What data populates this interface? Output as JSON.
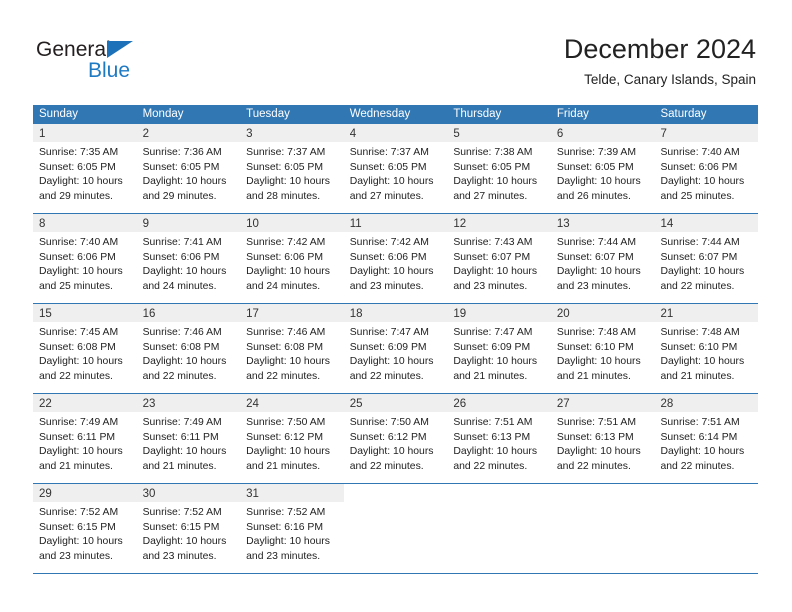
{
  "brand": {
    "name_part1": "General",
    "name_part2": "Blue",
    "triangle_color": "#1d71b8",
    "blue_color": "#1f7ac4"
  },
  "header": {
    "month_title": "December 2024",
    "location": "Telde, Canary Islands, Spain"
  },
  "theme": {
    "header_row_bg": "#3077b4",
    "daynum_bg": "#efefef",
    "text_color": "#222222"
  },
  "weekdays": [
    "Sunday",
    "Monday",
    "Tuesday",
    "Wednesday",
    "Thursday",
    "Friday",
    "Saturday"
  ],
  "weeks": [
    [
      {
        "day": "1",
        "sunrise": "Sunrise: 7:35 AM",
        "sunset": "Sunset: 6:05 PM",
        "daylight1": "Daylight: 10 hours",
        "daylight2": "and 29 minutes."
      },
      {
        "day": "2",
        "sunrise": "Sunrise: 7:36 AM",
        "sunset": "Sunset: 6:05 PM",
        "daylight1": "Daylight: 10 hours",
        "daylight2": "and 29 minutes."
      },
      {
        "day": "3",
        "sunrise": "Sunrise: 7:37 AM",
        "sunset": "Sunset: 6:05 PM",
        "daylight1": "Daylight: 10 hours",
        "daylight2": "and 28 minutes."
      },
      {
        "day": "4",
        "sunrise": "Sunrise: 7:37 AM",
        "sunset": "Sunset: 6:05 PM",
        "daylight1": "Daylight: 10 hours",
        "daylight2": "and 27 minutes."
      },
      {
        "day": "5",
        "sunrise": "Sunrise: 7:38 AM",
        "sunset": "Sunset: 6:05 PM",
        "daylight1": "Daylight: 10 hours",
        "daylight2": "and 27 minutes."
      },
      {
        "day": "6",
        "sunrise": "Sunrise: 7:39 AM",
        "sunset": "Sunset: 6:05 PM",
        "daylight1": "Daylight: 10 hours",
        "daylight2": "and 26 minutes."
      },
      {
        "day": "7",
        "sunrise": "Sunrise: 7:40 AM",
        "sunset": "Sunset: 6:06 PM",
        "daylight1": "Daylight: 10 hours",
        "daylight2": "and 25 minutes."
      }
    ],
    [
      {
        "day": "8",
        "sunrise": "Sunrise: 7:40 AM",
        "sunset": "Sunset: 6:06 PM",
        "daylight1": "Daylight: 10 hours",
        "daylight2": "and 25 minutes."
      },
      {
        "day": "9",
        "sunrise": "Sunrise: 7:41 AM",
        "sunset": "Sunset: 6:06 PM",
        "daylight1": "Daylight: 10 hours",
        "daylight2": "and 24 minutes."
      },
      {
        "day": "10",
        "sunrise": "Sunrise: 7:42 AM",
        "sunset": "Sunset: 6:06 PM",
        "daylight1": "Daylight: 10 hours",
        "daylight2": "and 24 minutes."
      },
      {
        "day": "11",
        "sunrise": "Sunrise: 7:42 AM",
        "sunset": "Sunset: 6:06 PM",
        "daylight1": "Daylight: 10 hours",
        "daylight2": "and 23 minutes."
      },
      {
        "day": "12",
        "sunrise": "Sunrise: 7:43 AM",
        "sunset": "Sunset: 6:07 PM",
        "daylight1": "Daylight: 10 hours",
        "daylight2": "and 23 minutes."
      },
      {
        "day": "13",
        "sunrise": "Sunrise: 7:44 AM",
        "sunset": "Sunset: 6:07 PM",
        "daylight1": "Daylight: 10 hours",
        "daylight2": "and 23 minutes."
      },
      {
        "day": "14",
        "sunrise": "Sunrise: 7:44 AM",
        "sunset": "Sunset: 6:07 PM",
        "daylight1": "Daylight: 10 hours",
        "daylight2": "and 22 minutes."
      }
    ],
    [
      {
        "day": "15",
        "sunrise": "Sunrise: 7:45 AM",
        "sunset": "Sunset: 6:08 PM",
        "daylight1": "Daylight: 10 hours",
        "daylight2": "and 22 minutes."
      },
      {
        "day": "16",
        "sunrise": "Sunrise: 7:46 AM",
        "sunset": "Sunset: 6:08 PM",
        "daylight1": "Daylight: 10 hours",
        "daylight2": "and 22 minutes."
      },
      {
        "day": "17",
        "sunrise": "Sunrise: 7:46 AM",
        "sunset": "Sunset: 6:08 PM",
        "daylight1": "Daylight: 10 hours",
        "daylight2": "and 22 minutes."
      },
      {
        "day": "18",
        "sunrise": "Sunrise: 7:47 AM",
        "sunset": "Sunset: 6:09 PM",
        "daylight1": "Daylight: 10 hours",
        "daylight2": "and 22 minutes."
      },
      {
        "day": "19",
        "sunrise": "Sunrise: 7:47 AM",
        "sunset": "Sunset: 6:09 PM",
        "daylight1": "Daylight: 10 hours",
        "daylight2": "and 21 minutes."
      },
      {
        "day": "20",
        "sunrise": "Sunrise: 7:48 AM",
        "sunset": "Sunset: 6:10 PM",
        "daylight1": "Daylight: 10 hours",
        "daylight2": "and 21 minutes."
      },
      {
        "day": "21",
        "sunrise": "Sunrise: 7:48 AM",
        "sunset": "Sunset: 6:10 PM",
        "daylight1": "Daylight: 10 hours",
        "daylight2": "and 21 minutes."
      }
    ],
    [
      {
        "day": "22",
        "sunrise": "Sunrise: 7:49 AM",
        "sunset": "Sunset: 6:11 PM",
        "daylight1": "Daylight: 10 hours",
        "daylight2": "and 21 minutes."
      },
      {
        "day": "23",
        "sunrise": "Sunrise: 7:49 AM",
        "sunset": "Sunset: 6:11 PM",
        "daylight1": "Daylight: 10 hours",
        "daylight2": "and 21 minutes."
      },
      {
        "day": "24",
        "sunrise": "Sunrise: 7:50 AM",
        "sunset": "Sunset: 6:12 PM",
        "daylight1": "Daylight: 10 hours",
        "daylight2": "and 21 minutes."
      },
      {
        "day": "25",
        "sunrise": "Sunrise: 7:50 AM",
        "sunset": "Sunset: 6:12 PM",
        "daylight1": "Daylight: 10 hours",
        "daylight2": "and 22 minutes."
      },
      {
        "day": "26",
        "sunrise": "Sunrise: 7:51 AM",
        "sunset": "Sunset: 6:13 PM",
        "daylight1": "Daylight: 10 hours",
        "daylight2": "and 22 minutes."
      },
      {
        "day": "27",
        "sunrise": "Sunrise: 7:51 AM",
        "sunset": "Sunset: 6:13 PM",
        "daylight1": "Daylight: 10 hours",
        "daylight2": "and 22 minutes."
      },
      {
        "day": "28",
        "sunrise": "Sunrise: 7:51 AM",
        "sunset": "Sunset: 6:14 PM",
        "daylight1": "Daylight: 10 hours",
        "daylight2": "and 22 minutes."
      }
    ],
    [
      {
        "day": "29",
        "sunrise": "Sunrise: 7:52 AM",
        "sunset": "Sunset: 6:15 PM",
        "daylight1": "Daylight: 10 hours",
        "daylight2": "and 23 minutes."
      },
      {
        "day": "30",
        "sunrise": "Sunrise: 7:52 AM",
        "sunset": "Sunset: 6:15 PM",
        "daylight1": "Daylight: 10 hours",
        "daylight2": "and 23 minutes."
      },
      {
        "day": "31",
        "sunrise": "Sunrise: 7:52 AM",
        "sunset": "Sunset: 6:16 PM",
        "daylight1": "Daylight: 10 hours",
        "daylight2": "and 23 minutes."
      },
      {
        "day": "",
        "sunrise": "",
        "sunset": "",
        "daylight1": "",
        "daylight2": ""
      },
      {
        "day": "",
        "sunrise": "",
        "sunset": "",
        "daylight1": "",
        "daylight2": ""
      },
      {
        "day": "",
        "sunrise": "",
        "sunset": "",
        "daylight1": "",
        "daylight2": ""
      },
      {
        "day": "",
        "sunrise": "",
        "sunset": "",
        "daylight1": "",
        "daylight2": ""
      }
    ]
  ]
}
